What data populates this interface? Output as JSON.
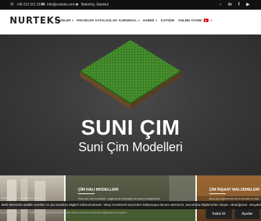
{
  "topbar": {
    "phone": "+90 212 511 15 86",
    "email": "info@nurteks.com.tr",
    "location": "Bakırköy, İstanbul",
    "social": [
      "instagram-icon",
      "linkedin-icon",
      "facebook-icon",
      "youtube-icon"
    ]
  },
  "header": {
    "logo": "NURTEKS",
    "nav": [
      {
        "label": "ÜRÜNLER",
        "dropdown": true
      },
      {
        "label": "PROJELER",
        "dropdown": false
      },
      {
        "label": "KATALOGLAR",
        "dropdown": false
      },
      {
        "label": "KURUMSAL",
        "dropdown": true
      },
      {
        "label": "HABER",
        "dropdown": true
      },
      {
        "label": "İLETİŞİM",
        "dropdown": false
      },
      {
        "label": "ONLINE STORE",
        "dropdown": false
      }
    ],
    "language_flag": "turkey-flag-icon"
  },
  "hero": {
    "title": "SUNI ÇIM",
    "subtitle": "Suni Çim Modelleri"
  },
  "cards": [
    {
      "title": "",
      "text_lines": [
        "İnden Turk kim ve dokuma ürünleri",
        "Uzman kadroyla... tek tüm aşama"
      ]
    },
    {
      "title": "ÇİM HALI MODELLERİ",
      "text_lines": [
        "Suni çim halı modelleri, doğal çimin estetiğini ve bakım maliyetlerini",
        "ortadan kaldırarak her alanda yeşil bir görünüm sağlar."
      ]
    },
    {
      "title": "ÇİM İNŞAAT MALZEMELERİ",
      "text_lines": [
        "Bina dış cephelerini nemi rutubet ve kötü",
        "hava koşullarına karşı korur."
      ]
    }
  ],
  "cookie": {
    "message": "Web sitemizde analitik çerezler ve çim tanıtılma bilgileri kullanılmaktadır. Siteyi incelemeli seçmeden kullanmaya devam ederseniz, tanımlama bilgilerinden oluşan. okuduğunuz. okuyabilirsiniz.",
    "more_text": "Ayrıntılı bilgi için Çerez Politikamızı inceleyebilirsiniz. Web sitesi çerezleri hakkında bilgilendirme sayfası",
    "accept_label": "Kabul Et",
    "settings_label": "Ayarlar"
  },
  "colors": {
    "topbar_bg": "#111111",
    "hero_bg": "#3a3a3a",
    "flag_red": "#e30a17"
  }
}
